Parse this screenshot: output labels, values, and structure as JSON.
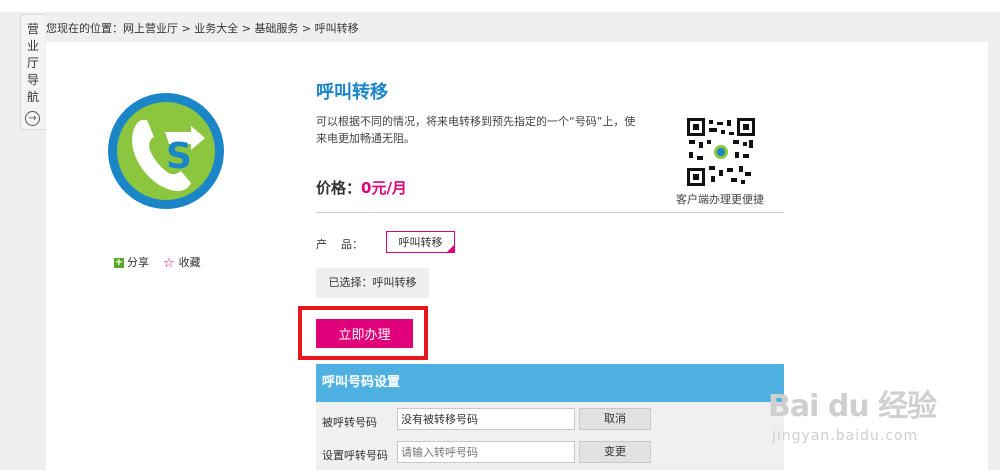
{
  "sidebar": {
    "label_chars": [
      "营",
      "业",
      "厅",
      "导",
      "航"
    ],
    "expand_glyph": "→"
  },
  "breadcrumb": {
    "prefix": "您现在的位置：",
    "items": [
      "网上营业厅",
      "业务大全",
      "基础服务",
      "呼叫转移"
    ],
    "separator": " > "
  },
  "product": {
    "title": "呼叫转移",
    "description": "可以根据不同的情况，将来电转移到预先指定的一个“号码”上，使来电更加畅通无阻。",
    "price_label": "价格：",
    "price_value": "0元/月",
    "qr_caption": "客户端办理更便捷",
    "product_label": "产    品：",
    "product_option": "呼叫转移",
    "selected_text": "已选择：呼叫转移",
    "apply_button": "立即办理"
  },
  "social": {
    "share_label": "分享",
    "favorite_label": "收藏"
  },
  "settings": {
    "heading": "呼叫号码设置",
    "rows": [
      {
        "label": "被呼转号码",
        "input_value": "没有被转移号码",
        "button": "取消"
      },
      {
        "label": "设置呼转号码",
        "input_placeholder": "请输入转呼号码",
        "button": "变更"
      }
    ]
  },
  "watermark": {
    "main": "Bai du 经验",
    "sub": "jingyan.baidu.com"
  },
  "colors": {
    "accent": "#e0007a",
    "title_blue": "#1a86c8",
    "section_blue": "#4fb1e2",
    "highlight_red": "#e8161d",
    "logo_blue": "#1a86c8",
    "logo_green": "#8cc63f"
  }
}
